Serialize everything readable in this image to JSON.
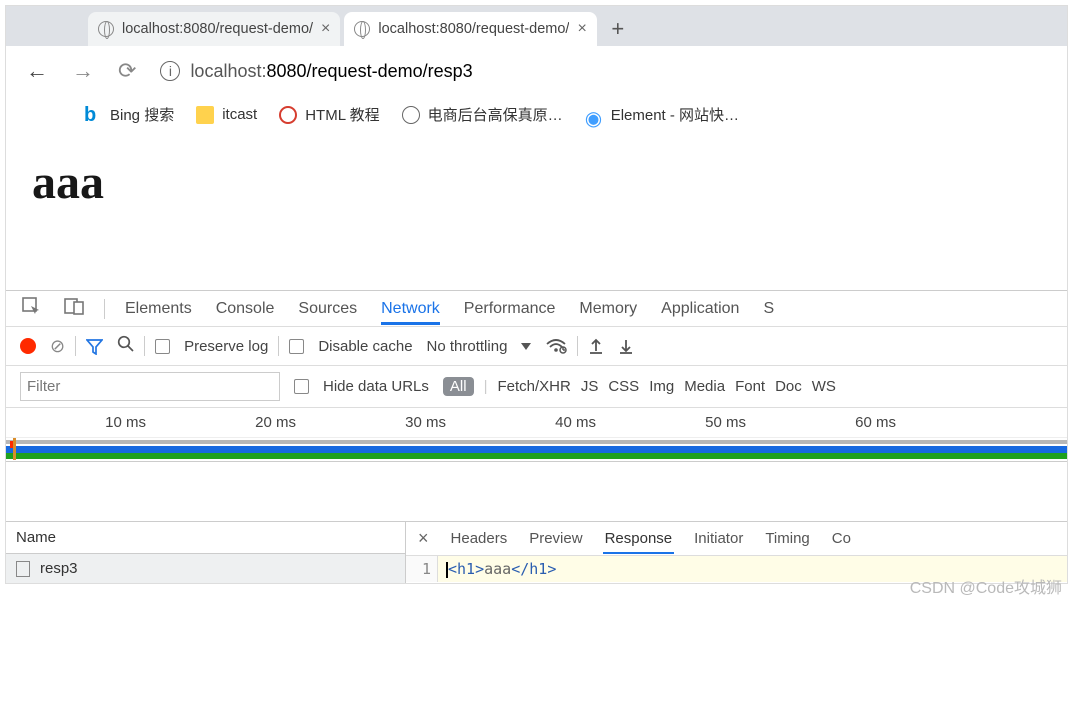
{
  "tabs": [
    {
      "title": "localhost:8080/request-demo/"
    },
    {
      "title": "localhost:8080/request-demo/"
    }
  ],
  "address": {
    "host": "localhost:",
    "port": "8080",
    "path": "/request-demo/resp3"
  },
  "bookmarks": [
    {
      "label": "Bing 搜索"
    },
    {
      "label": "itcast"
    },
    {
      "label": "HTML 教程"
    },
    {
      "label": "电商后台高保真原…"
    },
    {
      "label": "Element - 网站快…"
    }
  ],
  "page": {
    "heading": "aaa"
  },
  "devtools_tabs": {
    "elements": "Elements",
    "console": "Console",
    "sources": "Sources",
    "network": "Network",
    "performance": "Performance",
    "memory": "Memory",
    "application": "Application",
    "more": "S"
  },
  "network_toolbar": {
    "preserve_log": "Preserve log",
    "disable_cache": "Disable cache",
    "throttling": "No throttling"
  },
  "network_filter": {
    "placeholder": "Filter",
    "hide_data_urls": "Hide data URLs",
    "all": "All",
    "types": [
      "Fetch/XHR",
      "JS",
      "CSS",
      "Img",
      "Media",
      "Font",
      "Doc",
      "WS"
    ]
  },
  "timeline": {
    "ticks": [
      "10 ms",
      "20 ms",
      "30 ms",
      "40 ms",
      "50 ms",
      "60 ms"
    ]
  },
  "requests": {
    "col_name": "Name",
    "rows": [
      {
        "name": "resp3"
      }
    ]
  },
  "detail_tabs": {
    "headers": "Headers",
    "preview": "Preview",
    "response": "Response",
    "initiator": "Initiator",
    "timing": "Timing",
    "more": "Co"
  },
  "response_body": {
    "line": "1",
    "open": "<h1>",
    "text": "aaa",
    "close": "</h1>"
  },
  "watermark": "CSDN @Code攻城狮"
}
